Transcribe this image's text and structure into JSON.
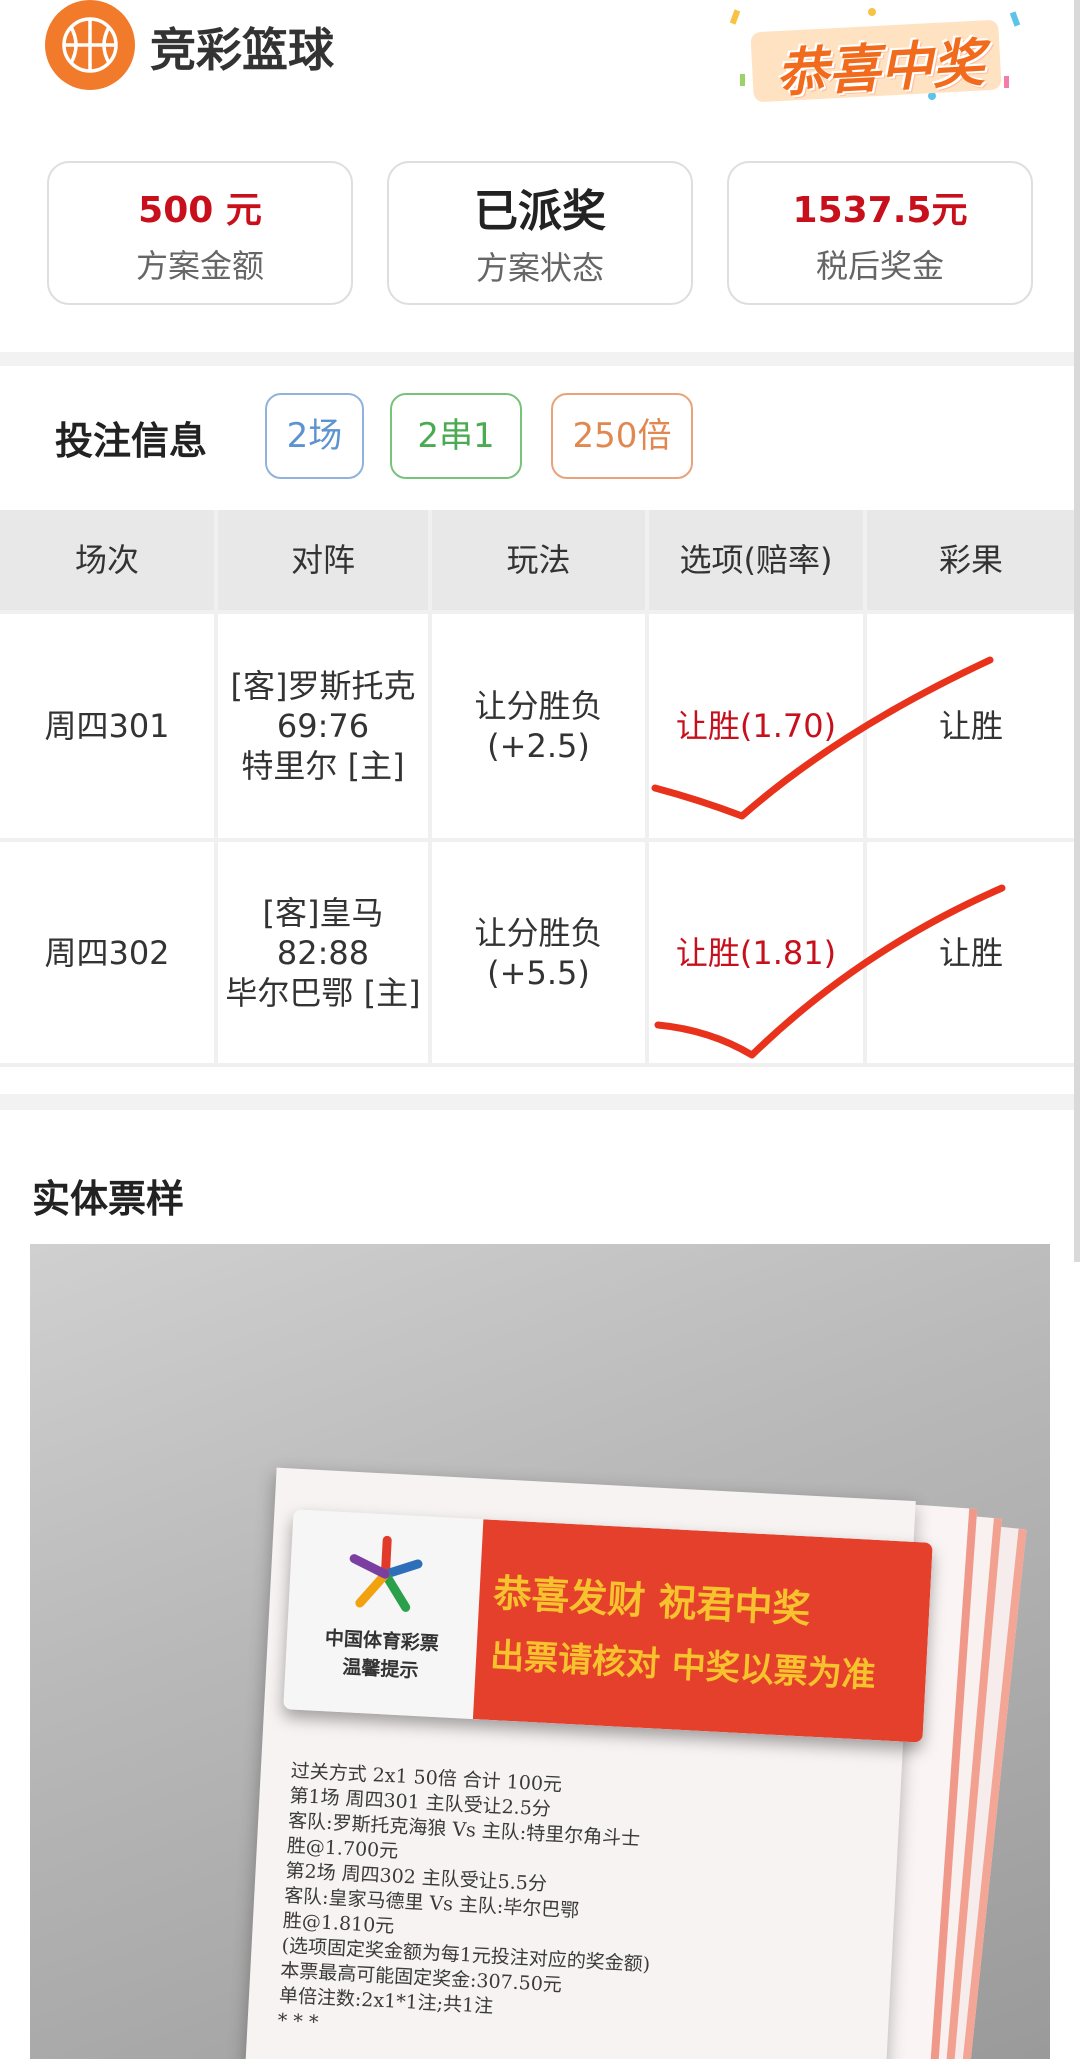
{
  "header": {
    "app_title": "竞彩篮球",
    "logo_icon": "basketball-icon",
    "congrats_badge": "恭喜中奖"
  },
  "summary": [
    {
      "value": "500 元",
      "label": "方案金额"
    },
    {
      "value": "已派奖",
      "label": "方案状态"
    },
    {
      "value": "1537.5元",
      "label": "税后奖金"
    }
  ],
  "bet_info": {
    "title": "投注信息",
    "tags": [
      "2场",
      "2串1",
      "250倍"
    ]
  },
  "table": {
    "headers": [
      "场次",
      "对阵",
      "玩法",
      "选项(赔率)",
      "彩果"
    ],
    "rows": [
      {
        "match_no": "周四301",
        "away": "[客]罗斯托克",
        "score": "69:76",
        "home": "特里尔 [主]",
        "play": "让分胜负",
        "handicap": "(+2.5)",
        "option": "让胜(1.70)",
        "result": "让胜"
      },
      {
        "match_no": "周四302",
        "away": "[客]皇马",
        "score": "82:88",
        "home": "毕尔巴鄂 [主]",
        "play": "让分胜负",
        "handicap": "(+5.5)",
        "option": "让胜(1.81)",
        "result": "让胜"
      }
    ]
  },
  "ticket_section": {
    "title": "实体票样",
    "plaque_line1": "恭喜发财 祝君中奖",
    "plaque_line2": "出票请核对 中奖以票为准",
    "plaque_org": "中国体育彩票",
    "plaque_org2": "温馨提示",
    "ticket_lines": [
      "过关方式 2x1        50倍              合计 100元",
      "第1场  周四301   主队受让2.5分",
      "客队:罗斯托克海狼 Vs 主队:特里尔角斗士",
      "胜@1.700元",
      "第2场  周四302   主队受让5.5分",
      "客队:皇家马德里 Vs 主队:毕尔巴鄂",
      "胜@1.810元",
      "(选项固定奖金额为每1元投注对应的奖金额)",
      "本票最高可能固定奖金:307.50元",
      "单倍注数:2x1*1注;共1注",
      "*  *  *"
    ]
  }
}
